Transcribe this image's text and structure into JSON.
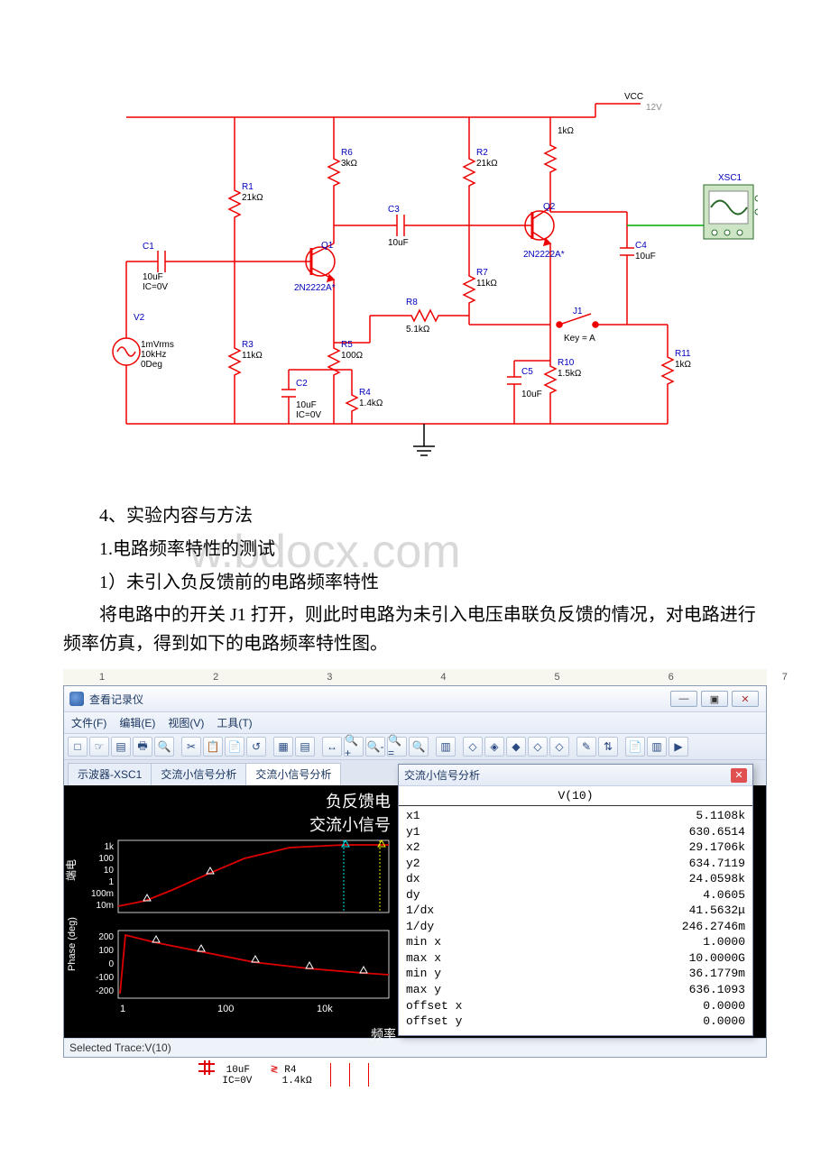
{
  "circuit": {
    "vcc_label": "VCC",
    "vcc_value": "12V",
    "r1": {
      "name": "R1",
      "val": "21kΩ"
    },
    "r2": {
      "name": "R2",
      "val": "21kΩ"
    },
    "r3": {
      "name": "R3",
      "val": "11kΩ"
    },
    "r4": {
      "name": "R4",
      "val": "1.4kΩ"
    },
    "r5": {
      "name": "R5",
      "val": "100Ω"
    },
    "r6": {
      "name": "R6",
      "val": "3kΩ"
    },
    "r7": {
      "name": "R7",
      "val": "11kΩ"
    },
    "r8": {
      "name": "R8",
      "val": "5.1kΩ"
    },
    "r10": {
      "name": "R10",
      "val": "1.5kΩ"
    },
    "r11": {
      "name": "R11",
      "val": "1kΩ"
    },
    "r_top": {
      "name": "",
      "val": "1kΩ"
    },
    "c1": {
      "name": "C1",
      "val": "10uF",
      "ic": "IC=0V"
    },
    "c2": {
      "name": "C2",
      "val": "10uF",
      "ic": "IC=0V"
    },
    "c3": {
      "name": "C3",
      "val": "10uF"
    },
    "c4": {
      "name": "C4",
      "val": "10uF"
    },
    "c5": {
      "name": "C5",
      "val": "10uF"
    },
    "q1": {
      "name": "Q1",
      "model": "2N2222A*"
    },
    "q2": {
      "name": "Q2",
      "model": "2N2222A*"
    },
    "j1": {
      "name": "J1",
      "key": "Key = A"
    },
    "src": {
      "name": "V2",
      "l1": "1mVrms",
      "l2": "10kHz",
      "l3": "0Deg"
    },
    "scope": "XSC1"
  },
  "text": {
    "h4": "4、实验内容与方法",
    "s1": "1.电路频率特性的测试",
    "s11": "1）未引入负反馈前的电路频率特性",
    "p1": "将电路中的开关 J1 打开，则此时电路为未引入电压串联负反馈的情况，对电路进行频率仿真，得到如下的电路频率特性图。",
    "watermark": "w.bdocx.com"
  },
  "viewer": {
    "ruler": [
      "1",
      "2",
      "3",
      "4",
      "5",
      "6",
      "7"
    ],
    "title": "查看记录仪",
    "menus": [
      "文件(F)",
      "编辑(E)",
      "视图(V)",
      "工具(T)"
    ],
    "winbtns": {
      "min": "—",
      "max": "▣",
      "close": "✕"
    },
    "toolbar_icons": [
      "□",
      "☞",
      "▤",
      "🖶",
      "🔍",
      "‖",
      "✂",
      "📋",
      "📄",
      "↺",
      "‖",
      "▦",
      "▤",
      "‖",
      "↔",
      "🔍+",
      "🔍-",
      "🔍=",
      "🔍",
      "‖",
      "▥",
      "‖",
      "◇",
      "◈",
      "◆",
      "◇",
      "◇",
      "‖",
      "✎",
      "⇅",
      "‖",
      "📄",
      "▥",
      "▶"
    ],
    "tabs": [
      "示波器-XSC1",
      "交流小信号分析",
      "交流小信号分析"
    ],
    "active_tab": 2,
    "chart_title1": "负反馈电",
    "chart_title2": "交流小信号",
    "y_axis_mag": "端电",
    "y_axis_phase": "Phase (deg)",
    "x_axis": "频率",
    "status": "Selected Trace:V(10)"
  },
  "analysis": {
    "title": "交流小信号分析",
    "header": "V(10)",
    "rows": [
      {
        "k": "x1",
        "v": "5.1108k"
      },
      {
        "k": "y1",
        "v": "630.6514"
      },
      {
        "k": "x2",
        "v": "29.1706k"
      },
      {
        "k": "y2",
        "v": "634.7119"
      },
      {
        "k": "dx",
        "v": "24.0598k"
      },
      {
        "k": "dy",
        "v": "4.0605"
      },
      {
        "k": "1/dx",
        "v": "41.5632μ"
      },
      {
        "k": "1/dy",
        "v": "246.2746m"
      },
      {
        "k": "min x",
        "v": "1.0000"
      },
      {
        "k": "max x",
        "v": "10.0000G"
      },
      {
        "k": "min y",
        "v": "36.1779m"
      },
      {
        "k": "max y",
        "v": "636.1093"
      },
      {
        "k": "offset x",
        "v": "0.0000"
      },
      {
        "k": "offset y",
        "v": "0.0000"
      }
    ]
  },
  "chart_data": [
    {
      "type": "line",
      "title": "Magnitude",
      "x": [
        1,
        3,
        10,
        30,
        100,
        300,
        1000,
        3000,
        10000,
        30000
      ],
      "y": [
        0.01,
        0.03,
        0.1,
        1,
        10,
        100,
        500,
        630,
        636,
        635
      ],
      "xlabel": "频率",
      "ylabel": "端电",
      "xscale": "log",
      "yscale": "log",
      "yticks": [
        "10m",
        "100m",
        "1",
        "10",
        "100",
        "1k"
      ],
      "markers_x": [
        10,
        5110,
        29170
      ]
    },
    {
      "type": "line",
      "title": "Phase (deg)",
      "x": [
        1,
        3,
        10,
        30,
        100,
        300,
        1000,
        3000,
        10000,
        30000
      ],
      "y": [
        -200,
        200,
        150,
        130,
        100,
        50,
        0,
        -20,
        -50,
        -60
      ],
      "xlabel": "频率",
      "ylabel": "Phase (deg)",
      "xscale": "log",
      "yticks": [
        "-200",
        "-100",
        "0",
        "100",
        "200"
      ],
      "markers_x": [
        10,
        100,
        1000,
        10000
      ]
    }
  ],
  "lower_snip": {
    "cap": {
      "val": "10uF",
      "ic": "IC=0V"
    },
    "res": {
      "name": "R4",
      "val": "1.4kΩ"
    }
  }
}
